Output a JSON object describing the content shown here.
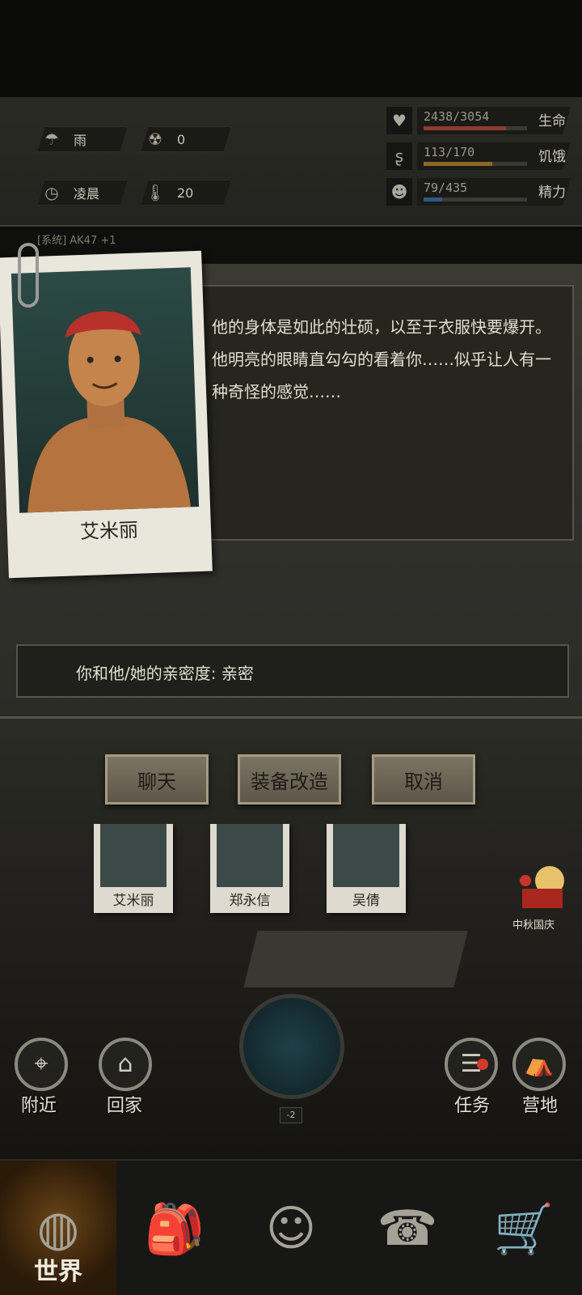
{
  "status": {
    "weather": "雨",
    "radiation": "0",
    "time_of_day": "凌晨",
    "temperature": "20",
    "health": {
      "value": "2438/3054",
      "label": "生命",
      "fraction": 0.798,
      "color": "#8e3a30"
    },
    "hunger": {
      "value": "113/170",
      "label": "饥饿",
      "fraction": 0.665,
      "color": "#8a6a2a"
    },
    "energy": {
      "value": "79/435",
      "label": "精力",
      "fraction": 0.182,
      "color": "#2d5a86"
    }
  },
  "log": {
    "text": "[系统] AK47 +1"
  },
  "dialog": {
    "character_name": "艾米丽",
    "description": "他的身体是如此的壮硕，以至于衣服快要爆开。他明亮的眼睛直勾勾的看着你……似乎让人有一种奇怪的感觉……",
    "intimacy": "你和他/她的亲密度: 亲密",
    "buttons": {
      "chat": "聊天",
      "modify": "装备改造",
      "cancel": "取消"
    }
  },
  "scene": {
    "npcs": [
      "艾米丽",
      "郑永信",
      "吴倩"
    ],
    "event_label": "中秋国庆",
    "level": "-2",
    "nearby": "附近",
    "home": "回家",
    "tasks": "任务",
    "camp": "营地"
  },
  "nav": {
    "world": "世界"
  }
}
